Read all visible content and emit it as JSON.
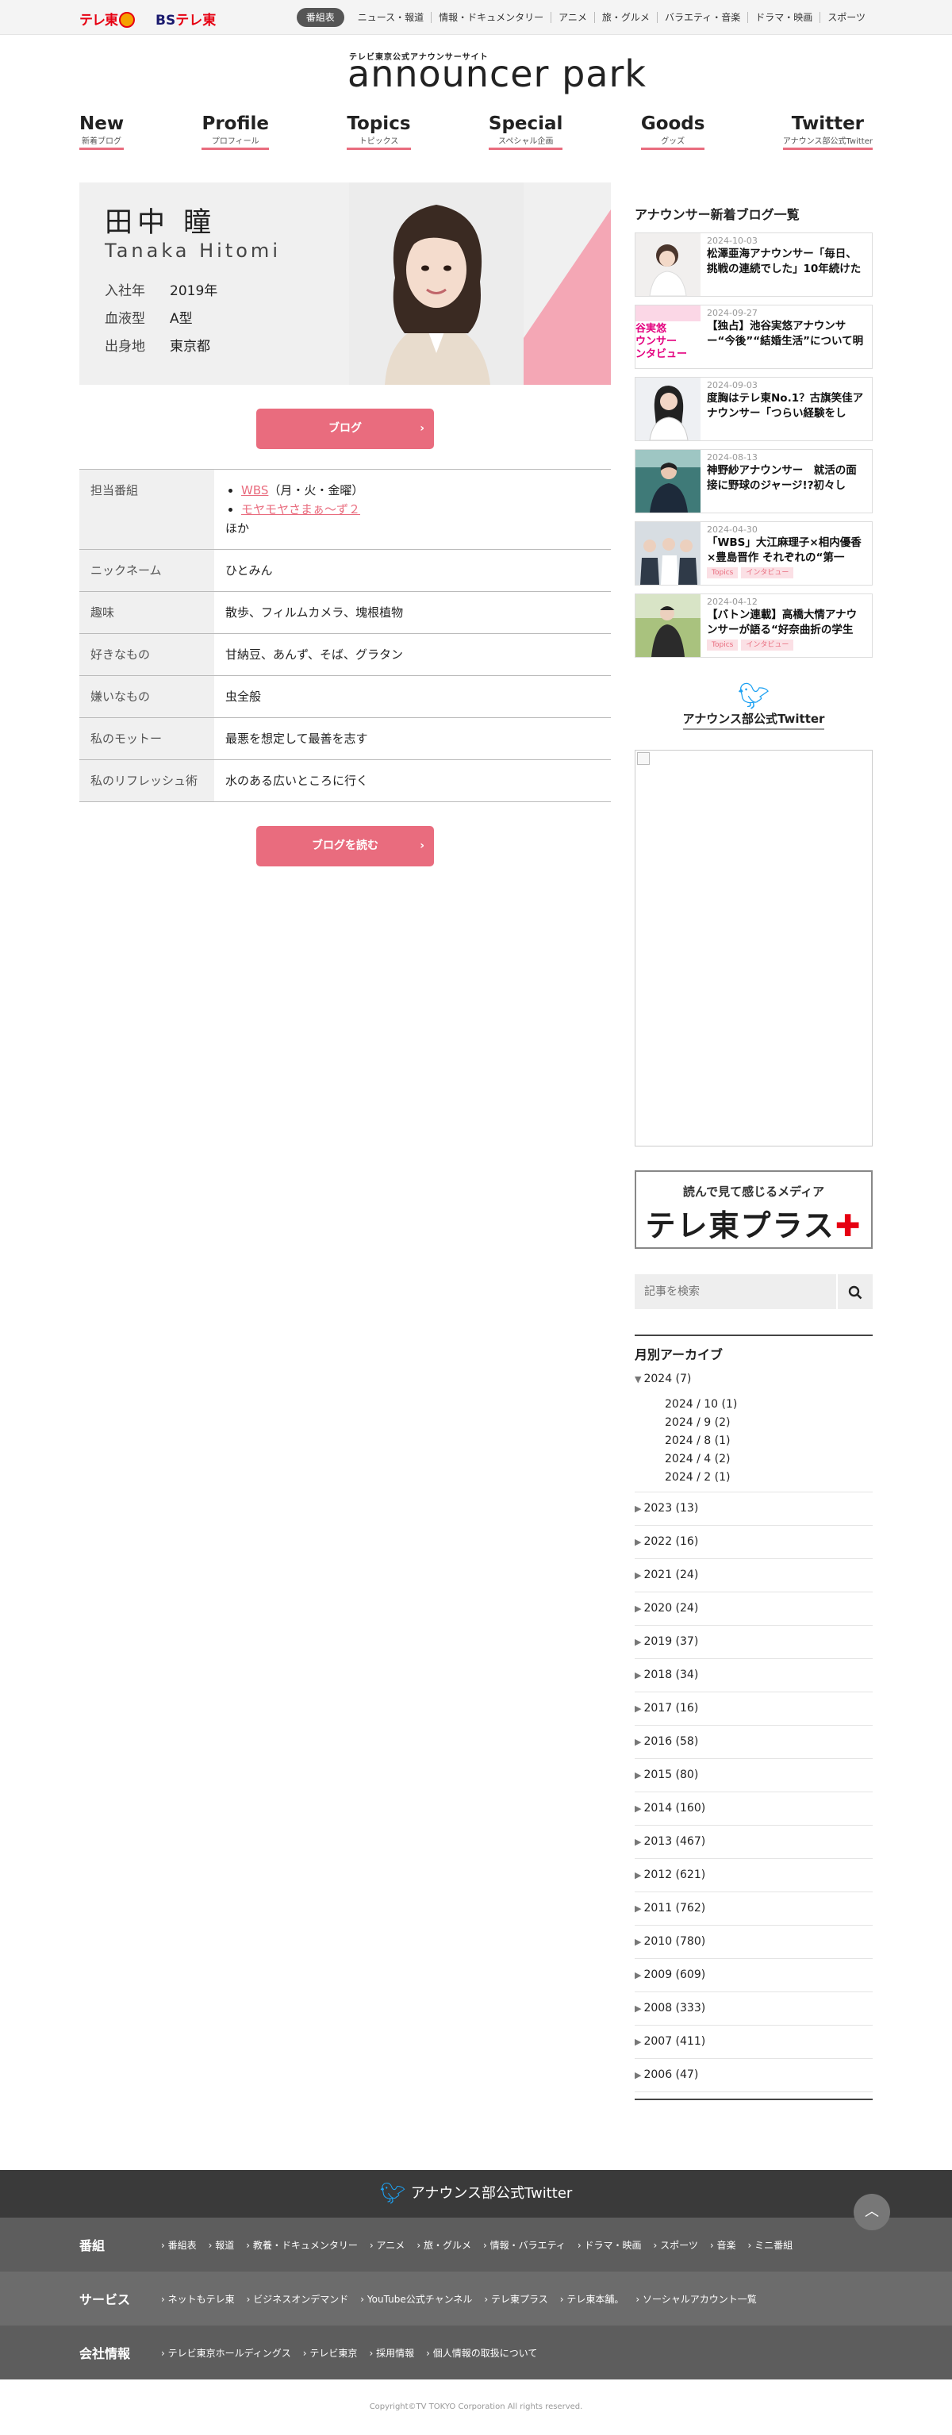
{
  "topbar": {
    "logo_tx": "テレ東",
    "logo_bs_prefix": "BS",
    "logo_bs_suffix": "テレ東",
    "nav": [
      "番組表",
      "ニュース・報道",
      "情報・ドキュメンタリー",
      "アニメ",
      "旅・グルメ",
      "バラエティ・音楽",
      "ドラマ・映画",
      "スポーツ"
    ]
  },
  "header": {
    "subtitle": "テレビ東京公式アナウンサーサイト",
    "title": "announcer park"
  },
  "main_nav": [
    {
      "en": "New",
      "ja": "新着ブログ"
    },
    {
      "en": "Profile",
      "ja": "プロフィール"
    },
    {
      "en": "Topics",
      "ja": "トピックス"
    },
    {
      "en": "Special",
      "ja": "スペシャル企画"
    },
    {
      "en": "Goods",
      "ja": "グッズ"
    },
    {
      "en": "Twitter",
      "ja": "アナウンス部公式Twitter"
    }
  ],
  "profile": {
    "name_ja": "田中 瞳",
    "name_en": "Tanaka Hitomi",
    "facts": [
      {
        "k": "入社年",
        "v": "2019年"
      },
      {
        "k": "血液型",
        "v": "A型"
      },
      {
        "k": "出身地",
        "v": "東京都"
      }
    ],
    "blog_button": "ブログ",
    "table": {
      "programs_label": "担当番組",
      "program1_link": "WBS",
      "program1_note": "（月・火・金曜）",
      "program2_link": "モヤモヤさまぁ～ず２",
      "programs_other": "ほか",
      "nickname_label": "ニックネーム",
      "nickname": "ひとみん",
      "hobby_label": "趣味",
      "hobby": "散歩、フィルムカメラ、塊根植物",
      "likes_label": "好きなもの",
      "likes": "甘納豆、あんず、そば、グラタン",
      "dislikes_label": "嫌いなもの",
      "dislikes": "虫全般",
      "motto_label": "私のモットー",
      "motto": "最悪を想定して最善を志す",
      "refresh_label": "私のリフレッシュ術",
      "refresh": "水のある広いところに行く"
    },
    "read_blog_button": "ブログを読む"
  },
  "sidebar": {
    "blog_heading": "アナウンサー新着ブログ一覧",
    "blogs": [
      {
        "date": "2024-10-03",
        "title": "松澤亜海アナウンサー「毎日、挑戦の連続でした」10年続けた",
        "tags": []
      },
      {
        "date": "2024-09-27",
        "title": "【独占】池谷実悠アナウンサー“今後”“結婚生活”について明か",
        "tags": []
      },
      {
        "date": "2024-09-03",
        "title": "度胸はテレ東No.1？古旗笑佳アナウンサー「つらい経験をし",
        "tags": []
      },
      {
        "date": "2024-08-13",
        "title": "神野紗アナウンサー　就活の面接に野球のジャージ!?初々し",
        "tags": []
      },
      {
        "date": "2024-04-30",
        "title": "「WBS」大江麻理子×相内優香×豊島晋作 それぞれの“第一",
        "tags": [
          "Topics",
          "インタビュー"
        ]
      },
      {
        "date": "2024-04-12",
        "title": "【バトン連載】高橋大情アナウンサーが語る“好奈曲折の学生",
        "tags": [
          "Topics",
          "インタビュー"
        ]
      }
    ],
    "thumb_overlay_text": "谷実悠\nウンサー\nンタビュー",
    "twitter_label": "アナウンス部公式Twitter",
    "banner_small": "読んで見て感じるメディア",
    "banner_big": "テレ東プラス",
    "search_placeholder": "記事を検索",
    "archive_title": "月別アーカイブ",
    "archive_open": "2024 (7)",
    "archive_months": [
      "2024 / 10 (1)",
      "2024 / 9 (2)",
      "2024 / 8 (1)",
      "2024 / 4 (2)",
      "2024 / 2 (1)"
    ],
    "archive_years": [
      "2023 (13)",
      "2022 (16)",
      "2021 (24)",
      "2020 (24)",
      "2019 (37)",
      "2018 (34)",
      "2017 (16)",
      "2016 (58)",
      "2015 (80)",
      "2014 (160)",
      "2013 (467)",
      "2012 (621)",
      "2011 (762)",
      "2010 (780)",
      "2009 (609)",
      "2008 (333)",
      "2007 (411)",
      "2006 (47)"
    ]
  },
  "footer": {
    "twitter_label": "アナウンス部公式Twitter",
    "rows": [
      {
        "head": "番組",
        "links": [
          "番組表",
          "報道",
          "教養・ドキュメンタリー",
          "アニメ",
          "旅・グルメ",
          "情報・バラエティ",
          "ドラマ・映画",
          "スポーツ",
          "音楽",
          "ミニ番組"
        ]
      },
      {
        "head": "サービス",
        "links": [
          "ネットもテレ東",
          "ビジネスオンデマンド",
          "YouTube公式チャンネル",
          "テレ東プラス",
          "テレ東本舗。",
          "ソーシャルアカウント一覧"
        ]
      },
      {
        "head": "会社情報",
        "links": [
          "テレビ東京ホールディングス",
          "テレビ東京",
          "採用情報",
          "個人情報の取扱について"
        ]
      }
    ],
    "copyright": "Copyright©TV TOKYO Corporation All rights reserved."
  },
  "colors": {
    "accent": "#e96c7e",
    "twitter": "#1da1f2",
    "pink_triangle": "#f4a7b5"
  }
}
